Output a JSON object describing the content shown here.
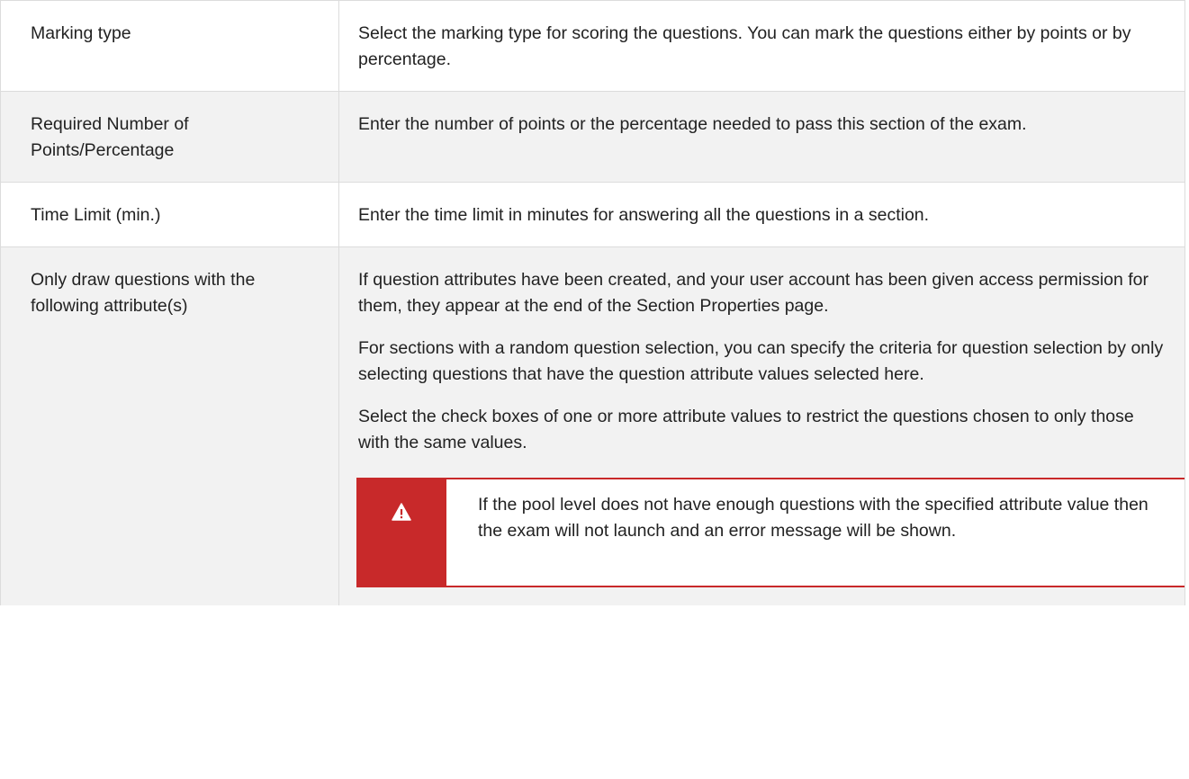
{
  "rows": [
    {
      "term": "Marking type",
      "paragraphs": [
        "Select the marking type for scoring the questions. You can mark the questions either by points or by percentage."
      ]
    },
    {
      "term": "Required Number of Points/Percentage",
      "paragraphs": [
        "Enter the number of points or the percentage needed to pass this section of the exam."
      ]
    },
    {
      "term": "Time Limit (min.)",
      "paragraphs": [
        "Enter the time limit in minutes for answering all the questions in a section."
      ]
    },
    {
      "term": "Only draw questions with the following attribute(s)",
      "paragraphs": [
        "If question attributes have been created, and your user account has been given access permission for them, they appear at the end of the Section Properties page.",
        "For sections with a random question selection, you can specify the criteria for question selection by only selecting questions that have the question attribute values selected here.",
        "Select the check boxes of one or more attribute values to restrict the questions chosen to only those with the same values."
      ],
      "callout": {
        "icon": "warning-triangle-icon",
        "accent_color": "#c8292a",
        "text": "If the pool level does not have enough questions with the specified attribute value then the exam will not launch and an error message will be shown."
      }
    }
  ]
}
